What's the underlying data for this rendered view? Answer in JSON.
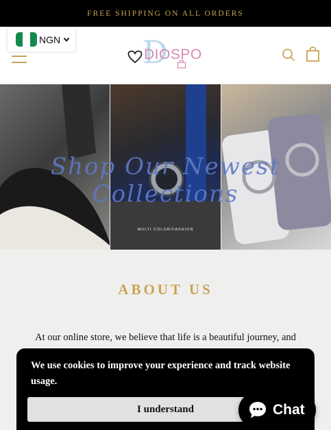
{
  "announcement": {
    "text": "FREE SHIPPING ON ALL ORDERS"
  },
  "currency": {
    "code": "NGN",
    "flag": "nigeria-flag"
  },
  "header": {
    "menu_icon": "hamburger-icon",
    "logo_text": "DIOSPO",
    "logo_letter": "D",
    "search_icon": "search-icon",
    "cart_icon": "shopping-bag-icon"
  },
  "hero": {
    "overlay_text": "Shop Our Newest Collections",
    "panel_caption": "MULTI COLOR/FASHION",
    "panels": [
      "sneaker-image",
      "watch-image",
      "phone-case-image"
    ]
  },
  "about": {
    "title": "ABOUT US",
    "text": "At our online store, we believe that life is a beautiful journey, and"
  },
  "cookie": {
    "message": "We use cookies to improve your experience and track website usage.",
    "button_label": "I understand"
  },
  "chat": {
    "label": "Chat",
    "icon": "chat-bubble-icon"
  },
  "colors": {
    "accent": "#c9a454",
    "announcement_bg": "#000000",
    "flag_green": "#118b4b",
    "logo_pink": "#d58ab3",
    "logo_blue": "#bcd9ee"
  }
}
